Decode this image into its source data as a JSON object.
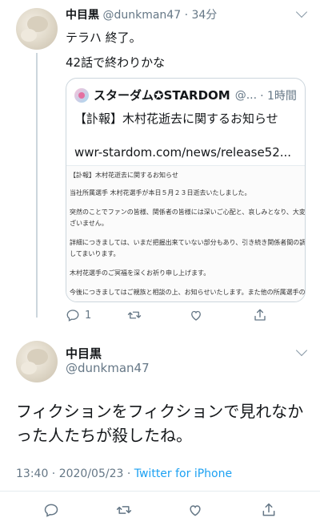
{
  "tweet1": {
    "display_name": "中目黒",
    "handle": "@dunkman47",
    "time": "· 34分",
    "lines": [
      "テラハ 終了。",
      "42話で終わりかな"
    ],
    "quote": {
      "display_name": "スターダム✪STARDOM",
      "handle": "@...",
      "time": "· 1時間",
      "title": "【訃報】木村花逝去に関するお知らせ",
      "link": "wwr-stardom.com/news/release52...",
      "document_lines": [
        "【訃報】木村花逝去に関するお知らせ",
        "当社所属選手 木村花選手が本日５月２３日逝去いたしました。",
        "突然のことでファンの皆様、関係者の皆様には深いご心配と、哀しみとなり、大変申し訳ご",
        "ざいません。",
        "詳細につきましては、いまだ把握出来ていない部分もあり、引き続き関係者間の調査に協力",
        "してまいります。",
        "木村花選手のご冥福を深くお祈り申し上げます。",
        "今後につきましてはご親族と相談の上、お知らせいたします。また他の所属選手の心のケア"
      ]
    },
    "actions": {
      "reply_count": "1",
      "reply_icon": "reply-icon",
      "retweet_icon": "retweet-icon",
      "like_icon": "like-icon",
      "share_icon": "share-icon"
    }
  },
  "tweet2": {
    "display_name": "中目黒",
    "handle": "@dunkman47",
    "text": "フィクションをフィクションで見れなかった人たちが殺したね。",
    "timestamp": "13:40 · 2020/05/23 · ",
    "source": "Twitter for iPhone"
  },
  "colors": {
    "accent": "#1da1f2",
    "muted": "#657786",
    "border": "#ccd6dd"
  }
}
